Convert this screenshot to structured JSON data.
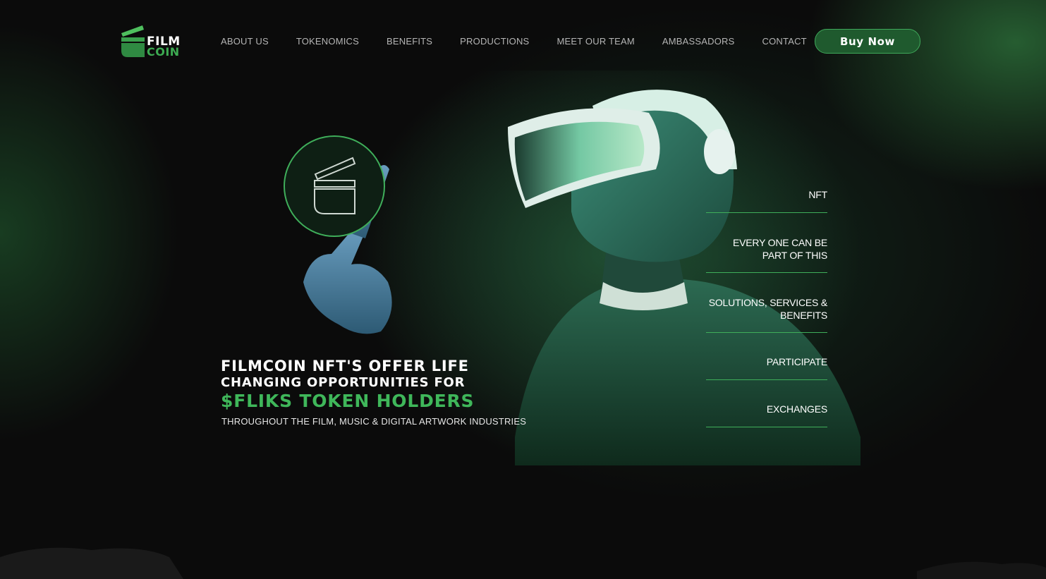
{
  "header": {
    "logo": {
      "line1": "FILM",
      "line2": "COIN"
    },
    "nav": [
      "ABOUT US",
      "TOKENOMICS",
      "BENEFITS",
      "PRODUCTIONS",
      "MEET OUR TEAM",
      "AMBASSADORS",
      "CONTACT"
    ],
    "buy_label": "Buy Now"
  },
  "hero": {
    "headline_line1": "FILMCOIN NFT'S OFFER LIFE",
    "headline_line2": "CHANGING OPPORTUNITIES FOR",
    "headline_line3": "$FLIKS TOKEN HOLDERS",
    "subline": "THROUGHOUT THE FILM, MUSIC & DIGITAL ARTWORK INDUSTRIES"
  },
  "side_menu": [
    {
      "line1": "NFT",
      "line2": ""
    },
    {
      "line1": "EVERY ONE CAN BE",
      "line2": "PART OF THIS"
    },
    {
      "line1": "SOLUTIONS, SERVICES &",
      "line2": "BENEFITS"
    },
    {
      "line1": "PARTICIPATE",
      "line2": ""
    },
    {
      "line1": "EXCHANGES",
      "line2": ""
    }
  ],
  "colors": {
    "background": "#0b0b0b",
    "accent_green": "#3fb75a",
    "button_fill": "#1f5a2e",
    "nav_text": "#b5b5b5",
    "divider": "#3fae5a"
  },
  "icons": {
    "logo": "film-clapper-logo-icon",
    "hologram": "clapperboard-hologram-icon"
  }
}
